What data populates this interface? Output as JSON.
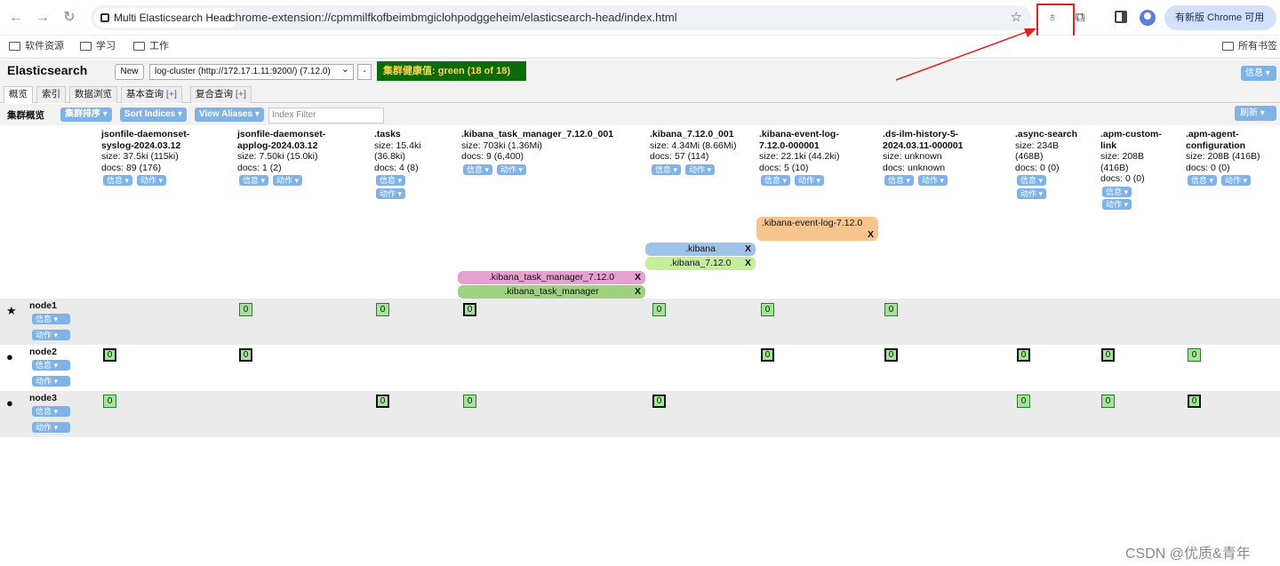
{
  "browser": {
    "tab_chip": "Multi Elasticsearch Head",
    "url": "chrome-extension://cpmmilfkofbeimbmgiclohpodggeheim/elasticsearch-head/index.html",
    "update_button": "有新版 Chrome 可用",
    "bookmarks": [
      "软件资源",
      "学习",
      "工作"
    ],
    "all_bookmarks": "所有书签"
  },
  "header": {
    "title": "Elasticsearch",
    "new_label": "New",
    "cluster_value": "log-cluster (http://172.17.1.11:9200/) (7.12.0)",
    "minus_label": "-",
    "health": "集群健康值: green (18 of 18)",
    "info_label": "信息 ▾"
  },
  "tabs": [
    {
      "label": "概览"
    },
    {
      "label": "索引"
    },
    {
      "label": "数据浏览"
    },
    {
      "label": "基本查询",
      "plus": "[+]"
    },
    {
      "label": "复合查询",
      "plus": "[+]"
    }
  ],
  "toolbar": {
    "label": "集群概览",
    "sort_cluster": "集群排序 ▾",
    "sort_indices": "Sort Indices ▾",
    "view_aliases": "View Aliases ▾",
    "filter_placeholder": "Index Filter",
    "refresh": "刷新 ▾"
  },
  "buttons": {
    "info": "信息 ▾",
    "action": "动作 ▾"
  },
  "indices": [
    {
      "name1": "jsonfile-daemonset-",
      "name2": "syslog-2024.03.12",
      "size": "size: 37.5ki (115ki)",
      "docs": "docs: 89 (176)"
    },
    {
      "name1": "jsonfile-daemonset-",
      "name2": "applog-2024.03.12",
      "size": "size: 7.50ki (15.0ki)",
      "docs": "docs: 1 (2)"
    },
    {
      "name1": ".tasks",
      "size": "size: 15.4ki",
      "size2": "(36.8ki)",
      "docs": "docs: 4 (8)"
    },
    {
      "name1": ".kibana_task_manager_7.12.0_001",
      "size": "size: 703ki (1.36Mi)",
      "docs": "docs: 9 (6,400)"
    },
    {
      "name1": ".kibana_7.12.0_001",
      "size": "size: 4.34Mi (8.66Mi)",
      "docs": "docs: 57 (114)"
    },
    {
      "name1": ".kibana-event-log-",
      "name2": "7.12.0-000001",
      "size": "size: 22.1ki (44.2ki)",
      "docs": "docs: 5 (10)"
    },
    {
      "name1": ".ds-ilm-history-5-",
      "name2": "2024.03.11-000001",
      "size": "size: unknown",
      "docs": "docs: unknown"
    },
    {
      "name1": ".async-search",
      "size": "size: 234B",
      "size2": "(468B)",
      "docs": "docs: 0 (0)"
    },
    {
      "name1": ".apm-custom-",
      "name2": "link",
      "size": "size: 208B",
      "size2": "(416B)",
      "docs": "docs: 0 (0)"
    },
    {
      "name1": ".apm-agent-",
      "name2": "configuration",
      "size": "size: 208B (416B)",
      "docs": "docs: 0 (0)"
    }
  ],
  "aliases": [
    {
      "label": ".kibana-event-log-7.12.0",
      "x": "X",
      "color": "#f6c58f"
    },
    {
      "label": ".kibana",
      "x": "X",
      "color": "#9ec3e8"
    },
    {
      "label": ".kibana_7.12.0",
      "x": "X",
      "color": "#c3ee9a"
    },
    {
      "label": ".kibana_task_manager_7.12.0",
      "x": "X",
      "color": "#e89fd1"
    },
    {
      "label": ".kibana_task_manager",
      "x": "X",
      "color": "#9fd27f"
    }
  ],
  "nodes": [
    {
      "name": "node1",
      "marker": "★"
    },
    {
      "name": "node2",
      "marker": "●"
    },
    {
      "name": "node3",
      "marker": "●"
    }
  ],
  "shard_label": "0",
  "watermark": "CSDN @优质&青年"
}
